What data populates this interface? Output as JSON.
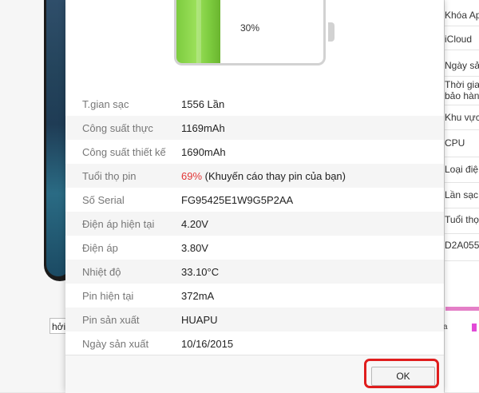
{
  "background": {
    "left_button_label": "hởi",
    "right_panel_items": [
      "Khóa Ap",
      "iCloud",
      "Ngày sả",
      "Thời gia",
      "bảo hành",
      "Khu vực",
      "CPU",
      "Loại điệ",
      "Lần sạc",
      "Tuổi thọ",
      "D2A055"
    ],
    "right_small_text": "a"
  },
  "battery": {
    "percent_label": "30%",
    "level": 0.3,
    "fill_color": "#7dcc3f"
  },
  "info": [
    {
      "label": "T.gian sạc",
      "value": "1556 Lần"
    },
    {
      "label": "Công suất thực",
      "value": "1169mAh"
    },
    {
      "label": "Công suất thiết kế",
      "value": "1690mAh"
    },
    {
      "label": "Tuổi thọ pin",
      "value": "69%",
      "note": " (Khuyến cáo thay pin của bạn)"
    },
    {
      "label": "Số Serial",
      "value": "FG95425E1W9G5P2AA"
    },
    {
      "label": "Điện áp hiện tại",
      "value": "4.20V"
    },
    {
      "label": "Điện áp",
      "value": "3.80V"
    },
    {
      "label": "Nhiệt độ",
      "value": "33.10°C"
    },
    {
      "label": "Pin hiện tại",
      "value": "372mA"
    },
    {
      "label": "Pin sản xuất",
      "value": "HUAPU"
    },
    {
      "label": "Ngày sản xuất",
      "value": "10/16/2015"
    }
  ],
  "footer": {
    "ok_label": "OK",
    "highlight_color": "#e01d1d",
    "warning_color": "#e23636"
  }
}
